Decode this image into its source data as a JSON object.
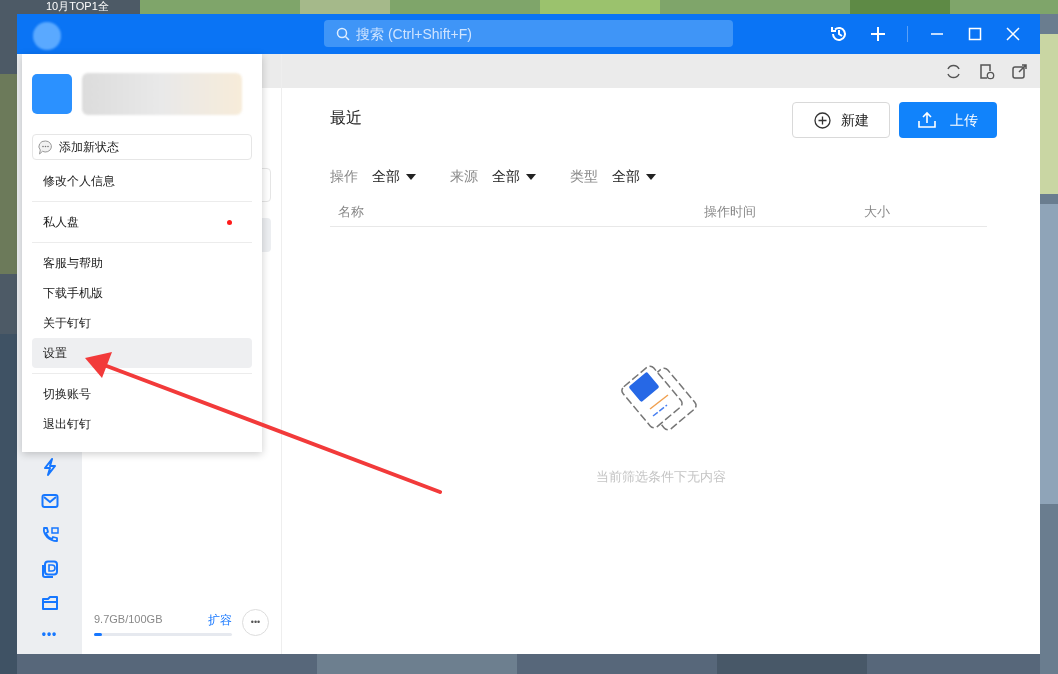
{
  "desktop": {
    "caption": "10月TOP1全"
  },
  "titlebar": {
    "search": {
      "placeholder": "搜索 (Ctrl+Shift+F)"
    }
  },
  "rail": {
    "more": "•••"
  },
  "storage": {
    "usage": "9.7GB/100GB",
    "level": 0.06,
    "expand_link": "扩容",
    "more_button": "•••"
  },
  "main": {
    "title": "最近",
    "buttons": [
      {
        "kind": "outline",
        "label": "新建"
      },
      {
        "kind": "primary",
        "label": "上传"
      }
    ],
    "filters": [
      {
        "label": "操作",
        "value": "全部"
      },
      {
        "label": "来源",
        "value": "全部"
      },
      {
        "label": "类型",
        "value": "全部"
      }
    ],
    "columns": [
      "名称",
      "操作时间",
      "大小"
    ],
    "empty_text": "当前筛选条件下无内容"
  },
  "profile_menu": {
    "status_button": "添加新状态",
    "groups": [
      [
        {
          "label": "修改个人信息",
          "selected": false,
          "badge": false
        }
      ],
      [
        {
          "label": "私人盘",
          "selected": false,
          "badge": true
        }
      ],
      [
        {
          "label": "客服与帮助",
          "selected": false,
          "badge": false
        },
        {
          "label": "下载手机版",
          "selected": false,
          "badge": false
        },
        {
          "label": "关于钉钉",
          "selected": false,
          "badge": false
        },
        {
          "label": "设置",
          "selected": true,
          "badge": false
        }
      ],
      [
        {
          "label": "切换账号",
          "selected": false,
          "badge": false
        },
        {
          "label": "退出钉钉",
          "selected": false,
          "badge": false
        }
      ]
    ]
  }
}
